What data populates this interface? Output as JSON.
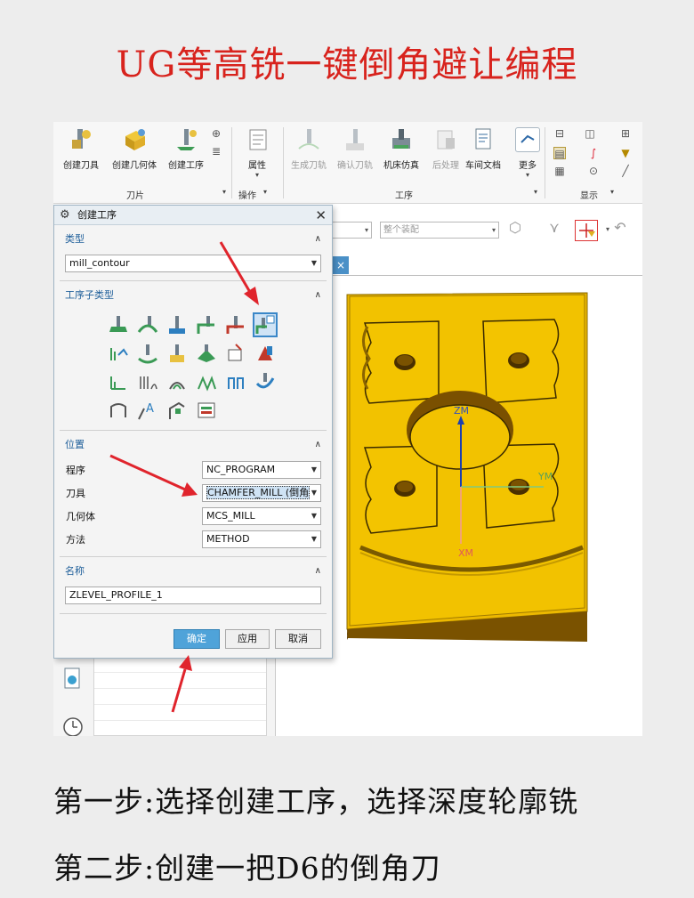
{
  "headline": "UG等高铣一键倒角避让编程",
  "ribbon": {
    "buttons": [
      {
        "label": "创建刀具",
        "icon": "create-tool-icon"
      },
      {
        "label": "创建几何体",
        "icon": "create-geometry-icon"
      },
      {
        "label": "创建工序",
        "icon": "create-operation-icon"
      },
      {
        "label": "属性",
        "icon": "properties-icon"
      },
      {
        "label": "生成刀轨",
        "icon": "generate-toolpath-icon"
      },
      {
        "label": "确认刀轨",
        "icon": "verify-toolpath-icon"
      },
      {
        "label": "机床仿真",
        "icon": "machine-simulation-icon"
      },
      {
        "label": "后处理",
        "icon": "postprocess-icon"
      },
      {
        "label": "车间文档",
        "icon": "shop-documentation-icon"
      },
      {
        "label": "更多",
        "icon": "more-icon"
      }
    ],
    "groups": [
      "刀片",
      "操作",
      "工序",
      "显示"
    ]
  },
  "graphics_toolbar": {
    "filter_combo": "",
    "assembly_combo": "整个装配"
  },
  "dialog": {
    "title": "创建工序",
    "type_section": "类型",
    "type_value": "mill_contour",
    "subtype_section": "工序子类型",
    "location_section": "位置",
    "fields": [
      {
        "label": "程序",
        "value": "NC_PROGRAM"
      },
      {
        "label": "刀具",
        "value": "CHAMFER_MILL (倒角"
      },
      {
        "label": "几何体",
        "value": "MCS_MILL"
      },
      {
        "label": "方法",
        "value": "METHOD"
      }
    ],
    "name_section": "名称",
    "name_value": "ZLEVEL_PROFILE_1",
    "buttons": {
      "ok": "确定",
      "apply": "应用",
      "cancel": "取消"
    }
  },
  "view": {
    "axes": {
      "z": "ZM",
      "y": "YM",
      "x": "XM"
    }
  },
  "steps": [
    "第一步:选择创建工序，选择深度轮廓铣",
    "第二步:创建一把D6的倒角刀"
  ],
  "colors": {
    "headline": "#d8231d",
    "part": "#f2c200",
    "arrow": "#e0242c",
    "accent": "#3a87c8"
  }
}
